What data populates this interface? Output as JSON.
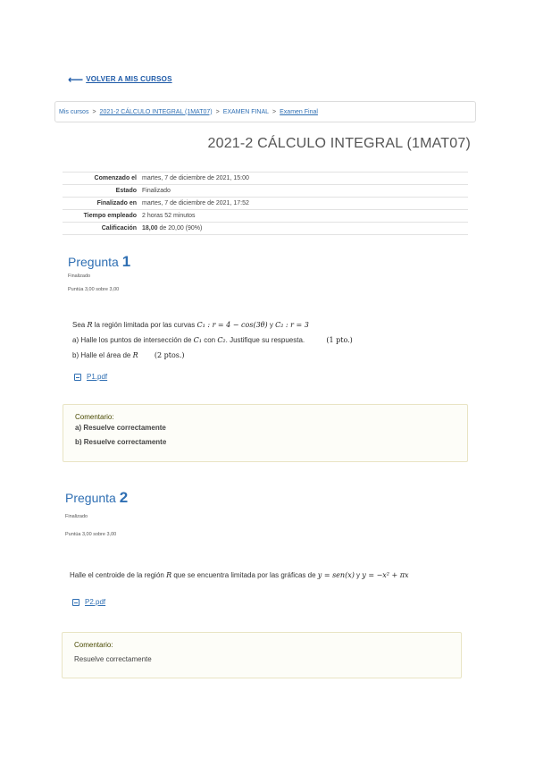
{
  "nav": {
    "back_label": "VOLVER A MIS CURSOS",
    "breadcrumb": {
      "mis_cursos": "Mis cursos",
      "course": "2021-2 CÁLCULO INTEGRAL (1MAT07)",
      "section": "EXAMEN FINAL",
      "exam": "Examen Final"
    }
  },
  "course_title": "2021-2 CÁLCULO INTEGRAL (1MAT07)",
  "summary": [
    {
      "label": "Comenzado el",
      "value": "martes, 7 de diciembre de 2021, 15:00"
    },
    {
      "label": "Estado",
      "value": "Finalizado"
    },
    {
      "label": "Finalizado en",
      "value": "martes, 7 de diciembre de 2021, 17:52"
    },
    {
      "label": "Tiempo empleado",
      "value": "2 horas 52 minutos"
    },
    {
      "label": "Calificación",
      "value_bold": "18,00",
      "value": " de 20,00 (90%)"
    }
  ],
  "q1": {
    "title": "Pregunta",
    "number": "1",
    "status": "Finalizado",
    "score": "Puntúa 3,00 sobre 3,00",
    "line1": {
      "a": "Sea ",
      "R": "R",
      "b": " la región limitada por las curvas ",
      "c1": "C₁ : r = 4 − cos(3θ)",
      "y": " y ",
      "c2": "C₂ : r = 3"
    },
    "line2": {
      "a": "a) Halle los puntos de intersección de ",
      "c1": "C₁",
      "b": " con ",
      "c2": "C₂",
      "c": ". Justifique su respuesta.",
      "pts": "(1 pto.)"
    },
    "line3": {
      "a": "b) Halle el área de ",
      "R": "R",
      "pts": "(2 ptos.)"
    },
    "file": "P1.pdf",
    "comment_label": "Comentario:",
    "comment_a": "a) Resuelve correctamente",
    "comment_b": "b) Resuelve correctamente"
  },
  "q2": {
    "title": "Pregunta",
    "number": "2",
    "status": "Finalizado",
    "score": "Puntúa 3,00 sobre 3,00",
    "text_a": "Halle el centroide de la región ",
    "R": "R",
    "text_b": " que se encuentra limitada por las gráficas de ",
    "eq1": "y = sen(x)",
    "text_y": " y ",
    "eq2": "y = −x² + πx",
    "file": "P2.pdf",
    "comment_label": "Comentario:",
    "comment": "Resuelve correctamente"
  }
}
